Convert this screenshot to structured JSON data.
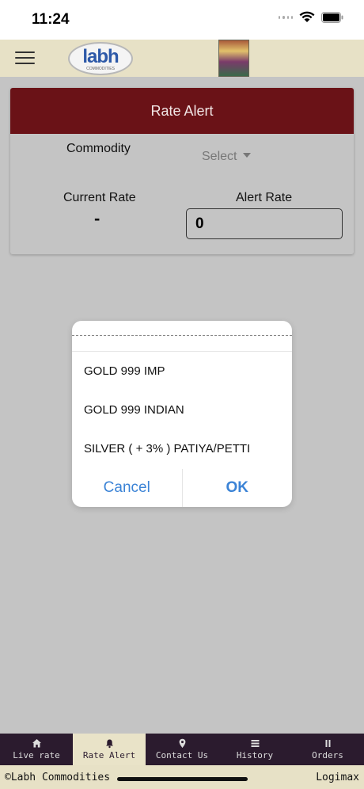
{
  "status_bar": {
    "time": "11:24"
  },
  "header": {
    "logo_text": "labh",
    "logo_subtext": "COMMODITIES"
  },
  "card": {
    "title": "Rate Alert",
    "commodity_label": "Commodity",
    "select_placeholder": "Select",
    "current_rate_label": "Current Rate",
    "current_rate_value": "-",
    "alert_rate_label": "Alert Rate",
    "alert_rate_value": "0"
  },
  "dialog": {
    "options": [
      {
        "label": "GOLD 999 IMP"
      },
      {
        "label": "GOLD 999 INDIAN"
      },
      {
        "label": "SILVER ( + 3% ) PATIYA/PETTI"
      }
    ],
    "cancel_label": "Cancel",
    "ok_label": "OK"
  },
  "bottom_nav": {
    "items": [
      {
        "label": "Live rate",
        "icon": "home-icon"
      },
      {
        "label": "Rate Alert",
        "icon": "bell-icon"
      },
      {
        "label": "Contact Us",
        "icon": "location-pin-icon"
      },
      {
        "label": "History",
        "icon": "list-icon"
      },
      {
        "label": "Orders",
        "icon": "pause-icon"
      }
    ],
    "active_index": 1
  },
  "footer": {
    "left_text": "©Labh Commodities",
    "right_text": "Logimax"
  },
  "colors": {
    "card_header": "#6a1217",
    "nav_bg": "#2b1b2e",
    "header_bg": "#e7e1c6",
    "accent_button": "#3b83d6"
  }
}
